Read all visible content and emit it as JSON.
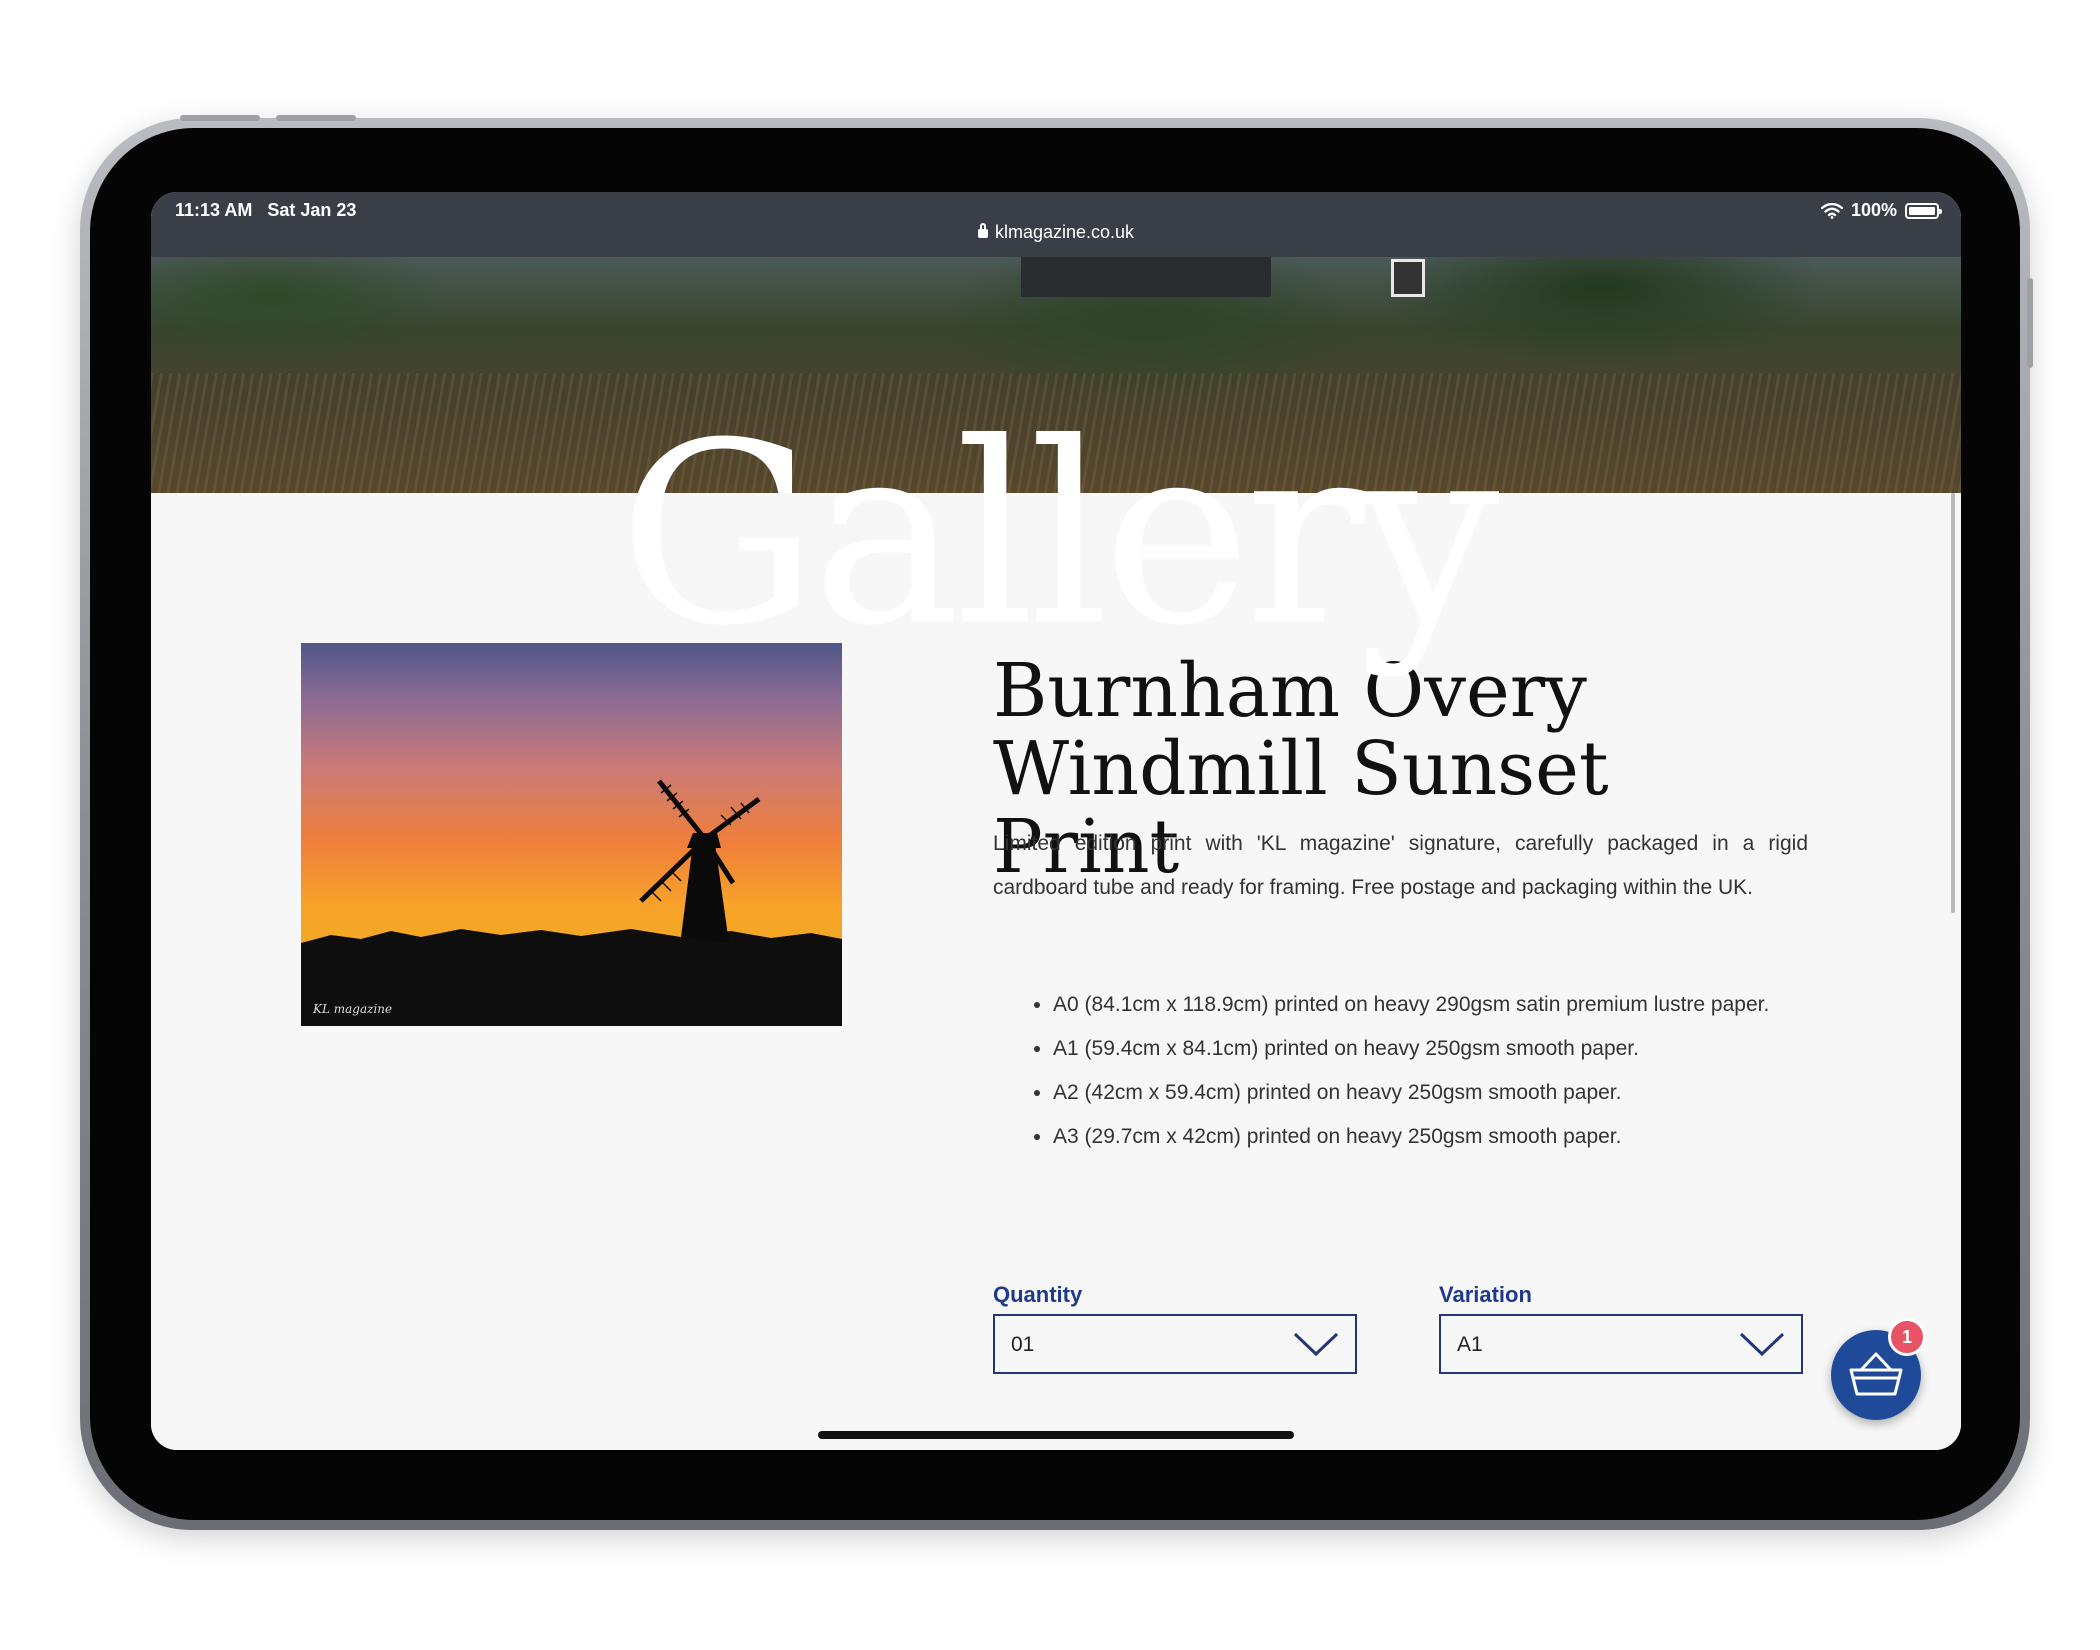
{
  "status_bar": {
    "time_date": "11:13 AM   Sat Jan 23",
    "url": "klmagazine.co.uk",
    "battery": "100%"
  },
  "hero": {
    "title": "Gallery"
  },
  "product": {
    "image_signature": "KL magazine",
    "title": "Burnham Overy Windmill Sunset Print",
    "description": "Limited edition print with 'KL magazine' signature, carefully packaged in a rigid cardboard tube and ready for framing. Free postage and packaging within the UK.",
    "specs": [
      "A0 (84.1cm x 118.9cm) printed on heavy 290gsm satin premium lustre paper.",
      "A1 (59.4cm x 84.1cm) printed on heavy 250gsm smooth paper.",
      "A2 (42cm x 59.4cm) printed on heavy 250gsm smooth paper.",
      "A3 (29.7cm x 42cm) printed on heavy 250gsm smooth paper."
    ]
  },
  "form": {
    "quantity_label": "Quantity",
    "quantity_value": "01",
    "variation_label": "Variation",
    "variation_value": "A1"
  },
  "cart": {
    "count": "1"
  },
  "colors": {
    "accent": "#1f3a8a",
    "cart": "#1f4a9a",
    "badge": "#e85466"
  }
}
